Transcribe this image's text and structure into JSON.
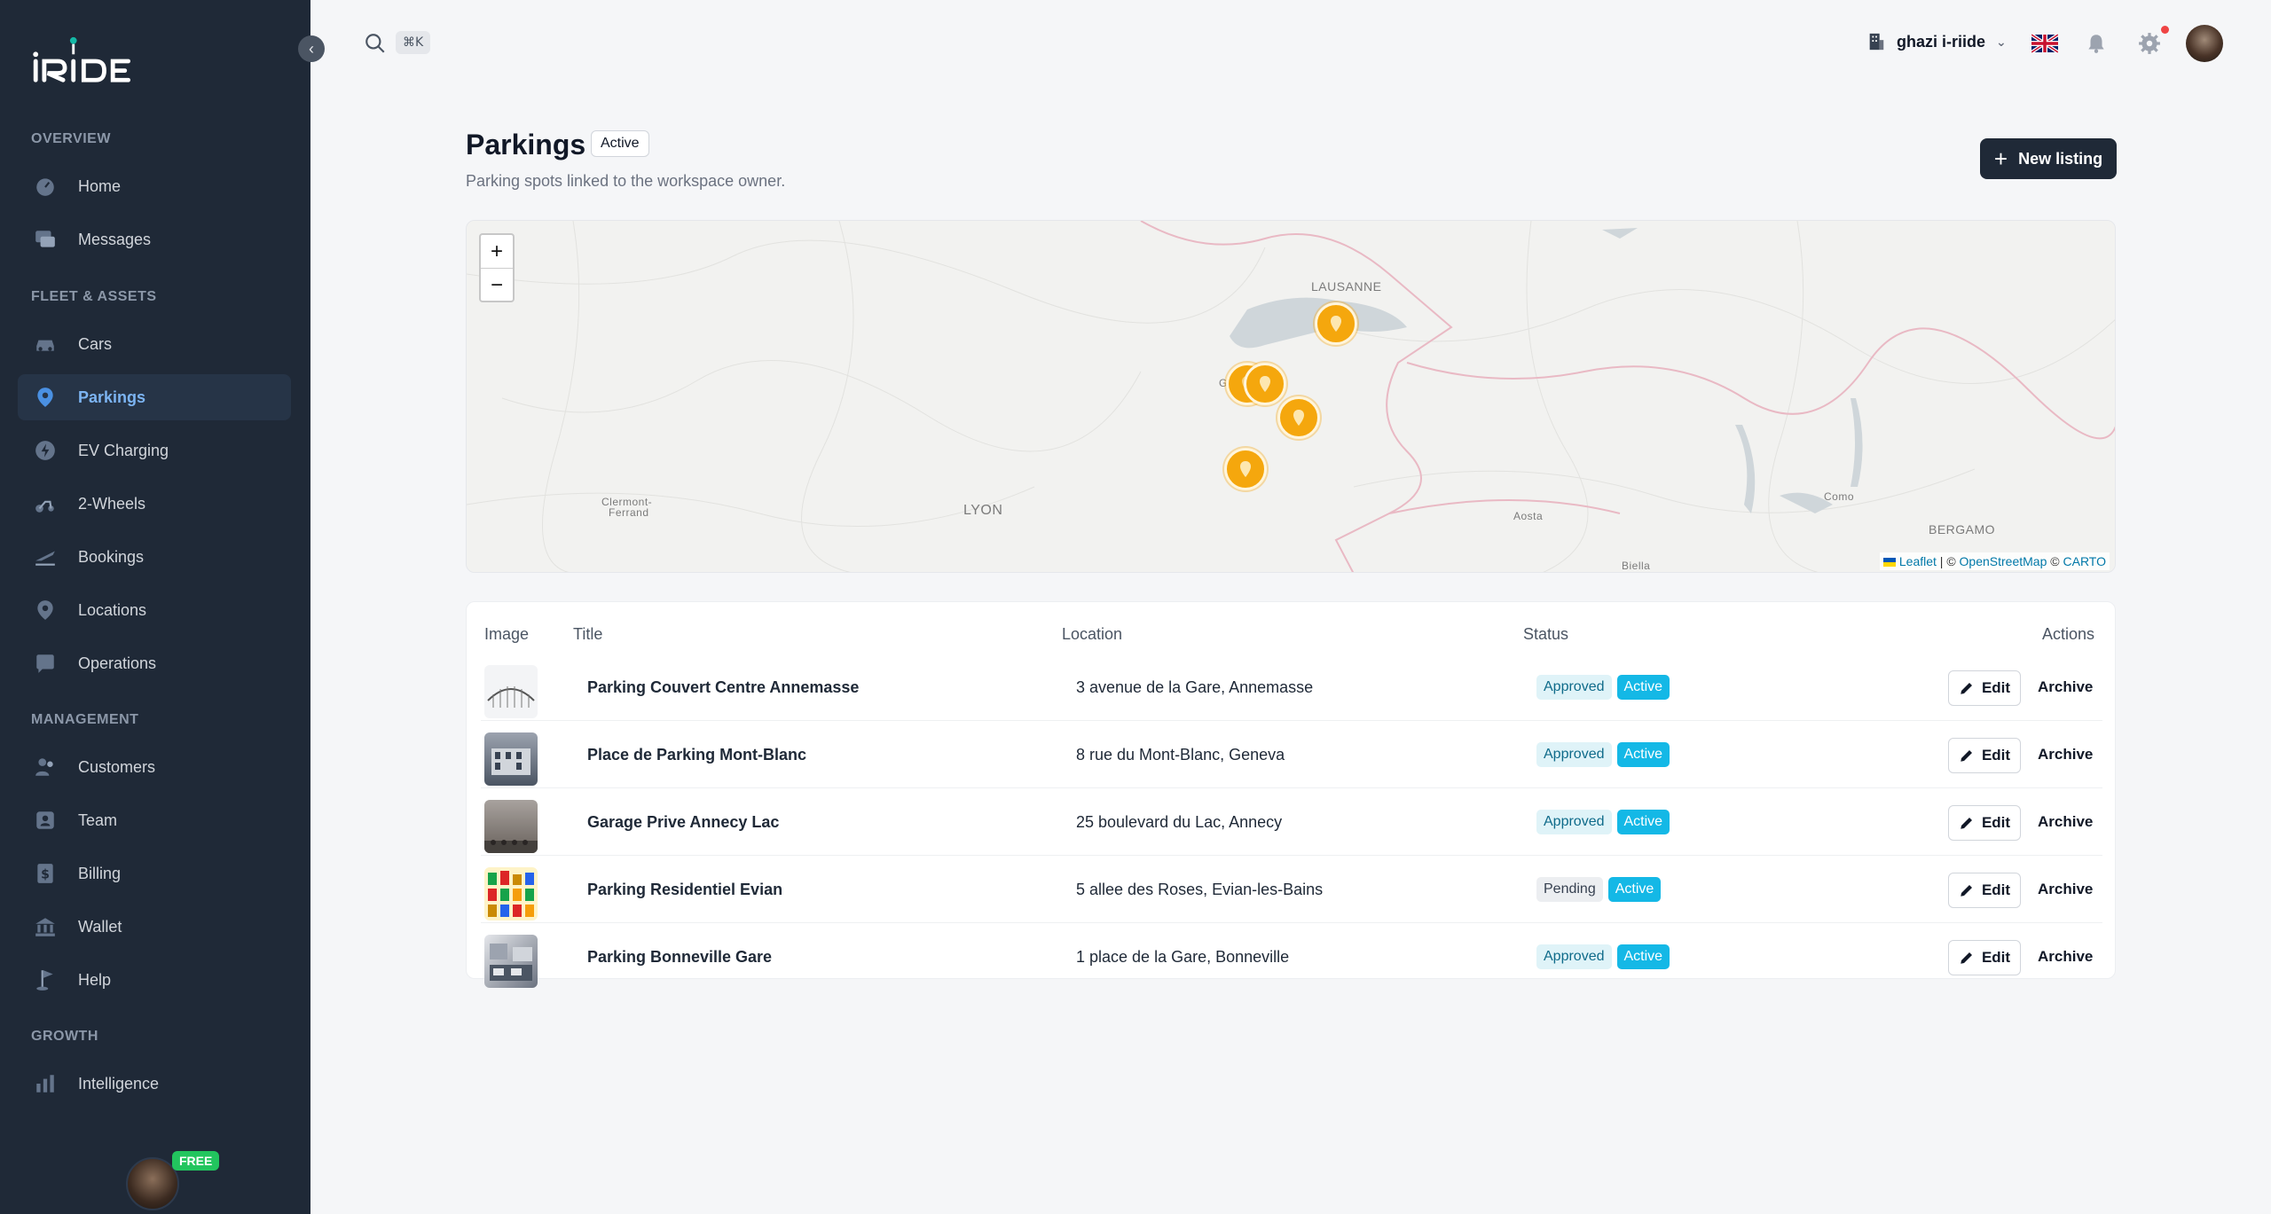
{
  "app": {
    "logo_text": "iRiDE",
    "collapse_icon": "chevron-left-icon"
  },
  "sidebar": {
    "sections": [
      {
        "label": "OVERVIEW"
      },
      {
        "label": "FLEET & ASSETS"
      },
      {
        "label": "MANAGEMENT"
      },
      {
        "label": "GROWTH"
      }
    ],
    "items": [
      {
        "label": "Home",
        "icon": "gauge-icon"
      },
      {
        "label": "Messages",
        "icon": "chat-icon"
      },
      {
        "label": "Cars",
        "icon": "car-icon"
      },
      {
        "label": "Parkings",
        "icon": "map-pin-icon",
        "active": true
      },
      {
        "label": "EV Charging",
        "icon": "lightning-icon"
      },
      {
        "label": "2-Wheels",
        "icon": "scooter-icon"
      },
      {
        "label": "Bookings",
        "icon": "plane-icon"
      },
      {
        "label": "Locations",
        "icon": "location-icon"
      },
      {
        "label": "Operations",
        "icon": "clipboard-icon"
      },
      {
        "label": "Customers",
        "icon": "users-icon"
      },
      {
        "label": "Team",
        "icon": "user-badge-icon"
      },
      {
        "label": "Billing",
        "icon": "dollar-icon"
      },
      {
        "label": "Wallet",
        "icon": "bank-icon"
      },
      {
        "label": "Help",
        "icon": "golf-flag-icon"
      },
      {
        "label": "Intelligence",
        "icon": "bar-chart-icon"
      }
    ],
    "plan_badge": "FREE"
  },
  "topbar": {
    "search_shortcut": "⌘K",
    "workspace_name": "ghazi i-riide",
    "language": "en-GB"
  },
  "header": {
    "title": "Parkings",
    "status": "Active",
    "subtitle": "Parking spots linked to the workspace owner.",
    "new_button": "New listing"
  },
  "map": {
    "zoom_in": "+",
    "zoom_out": "−",
    "labels": {
      "lausanne": "LAUSANNE",
      "lyon": "LYON",
      "clermont_1": "Clermont-",
      "clermont_2": "Ferrand",
      "aosta": "Aosta",
      "como": "Como",
      "bergamo": "BERGAMO",
      "biella": "Biella",
      "geneva_partial": "G"
    },
    "attribution": {
      "leaflet": "Leaflet",
      "sep1": " | © ",
      "osm": "OpenStreetMap",
      "sep2": " © ",
      "carto": "CARTO"
    },
    "marker_color": "#f5a70d"
  },
  "table": {
    "headers": {
      "image": "Image",
      "title": "Title",
      "location": "Location",
      "status": "Status",
      "actions": "Actions"
    },
    "edit_label": "Edit",
    "archive_label": "Archive",
    "rows": [
      {
        "title": "Parking Couvert Centre Annemasse",
        "location": "3 avenue de la Gare, Annemasse",
        "approval": "Approved",
        "state": "Active"
      },
      {
        "title": "Place de Parking Mont-Blanc",
        "location": "8 rue du Mont-Blanc, Geneva",
        "approval": "Approved",
        "state": "Active"
      },
      {
        "title": "Garage Prive Annecy Lac",
        "location": "25 boulevard du Lac, Annecy",
        "approval": "Approved",
        "state": "Active"
      },
      {
        "title": "Parking Residentiel Evian",
        "location": "5 allee des Roses, Evian-les-Bains",
        "approval": "Pending",
        "state": "Active"
      },
      {
        "title": "Parking Bonneville Gare",
        "location": "1 place de la Gare, Bonneville",
        "approval": "Approved",
        "state": "Active"
      }
    ]
  },
  "colors": {
    "sidebar_bg": "#1f2937",
    "accent": "#14b8e6",
    "active_nav": "#7cb4f2"
  }
}
